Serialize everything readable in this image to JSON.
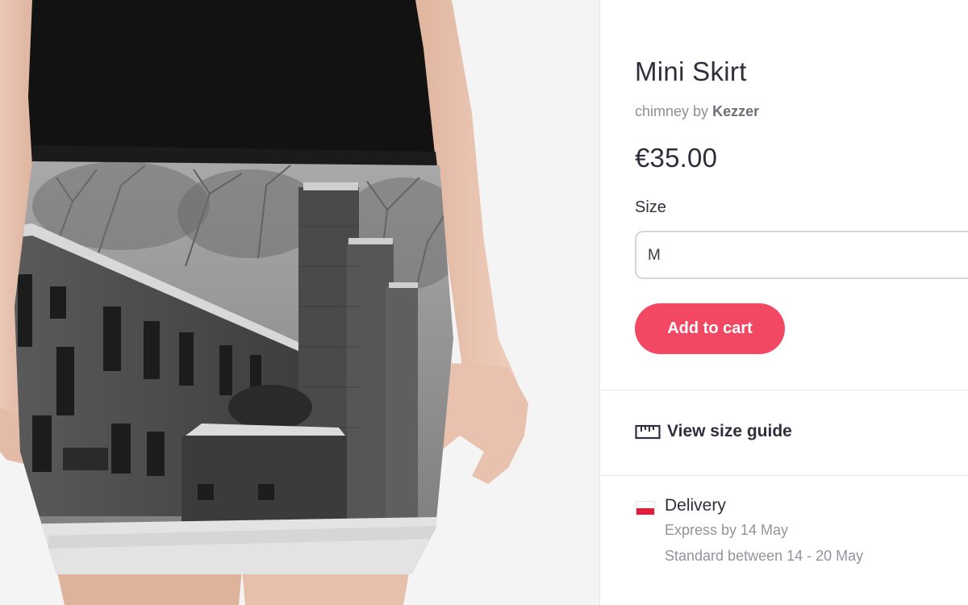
{
  "product": {
    "title": "Mini Skirt",
    "design_name": "chimney",
    "by_label": "by",
    "artist": "Kezzer",
    "price": "€35.00"
  },
  "size": {
    "label": "Size",
    "selected": "M"
  },
  "cart": {
    "add_label": "Add to cart"
  },
  "size_guide": {
    "label": "View size guide",
    "icon": "ruler-icon"
  },
  "delivery": {
    "flag": "poland-flag-icon",
    "title": "Delivery",
    "express": "Express by 14 May",
    "standard": "Standard between 14 - 20 May"
  },
  "colors": {
    "accent": "#f34864",
    "text": "#2f2f3c",
    "muted": "#8e9099"
  }
}
